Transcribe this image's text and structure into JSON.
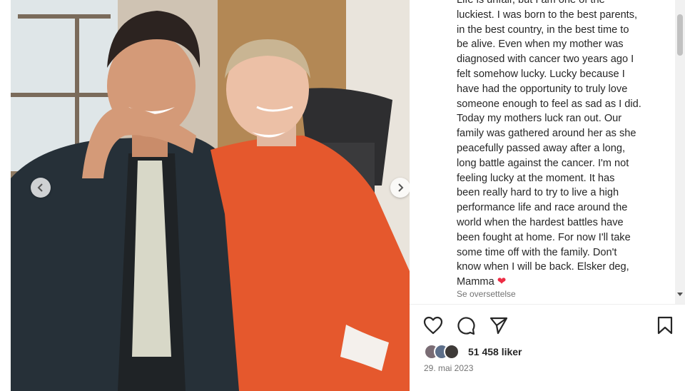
{
  "post": {
    "image_alt": "",
    "caption_lines": [
      "Life is unfair, but I am one of the",
      "luckiest. I was born to the best parents,",
      "in the best country, in the best time to",
      "be alive. Even when my mother was",
      "diagnosed with cancer two years ago I",
      "felt somehow lucky. Lucky because I",
      "have had the opportunity to truly love",
      "someone enough to feel as sad as I did.",
      "Today my mothers luck ran out. Our",
      "family was gathered around her as she",
      "peacefully passed away after a long,",
      "long battle against the cancer. I'm not",
      "feeling lucky at the moment. It has",
      "been really hard to try to live a high",
      "performance life and race around the",
      "world when the hardest battles have",
      "been fought at home. For now I'll take",
      "some time off with the family. Don't",
      "know when I will be back. Elsker deg,"
    ],
    "caption_last": "Mamma",
    "caption_emoji": "❤",
    "translate_label": "Se oversettelse",
    "likes_text": "51 458 liker",
    "date_text": "29. mai 2023"
  },
  "actions": {
    "like_icon": "heart-outline-icon",
    "comment_icon": "comment-icon",
    "share_icon": "send-icon",
    "save_icon": "bookmark-icon"
  },
  "colors": {
    "text": "#262626",
    "muted": "#737373",
    "heart": "#ed2c44"
  }
}
